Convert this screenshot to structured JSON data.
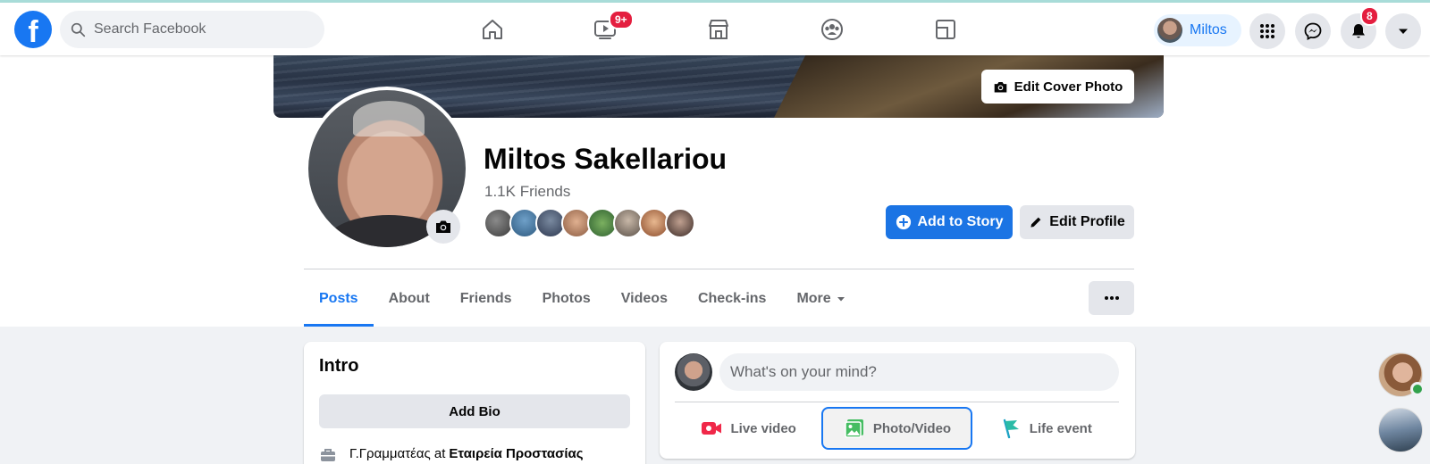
{
  "search": {
    "placeholder": "Search Facebook"
  },
  "nav": {
    "watch_badge": "9+",
    "notifications_badge": "8"
  },
  "header": {
    "profile_chip_name": "Miltos"
  },
  "cover": {
    "edit_label": "Edit Cover Photo"
  },
  "profile": {
    "name": "Miltos Sakellariou",
    "friends_count": "1.1K Friends",
    "add_story_label": "Add to Story",
    "edit_profile_label": "Edit Profile"
  },
  "tabs": [
    {
      "label": "Posts",
      "active": true
    },
    {
      "label": "About"
    },
    {
      "label": "Friends"
    },
    {
      "label": "Photos"
    },
    {
      "label": "Videos"
    },
    {
      "label": "Check-ins"
    },
    {
      "label": "More"
    }
  ],
  "intro": {
    "title": "Intro",
    "add_bio_label": "Add Bio",
    "work_role": "Γ.Γραμματέας at",
    "work_org": "Εταιρεία Προστασίας"
  },
  "composer": {
    "placeholder": "What's on your mind?",
    "live_video_label": "Live video",
    "photo_video_label": "Photo/Video",
    "life_event_label": "Life event"
  },
  "colors": {
    "brand_blue": "#1877f2",
    "badge_red": "#e41e3f",
    "online_green": "#31a24c"
  }
}
